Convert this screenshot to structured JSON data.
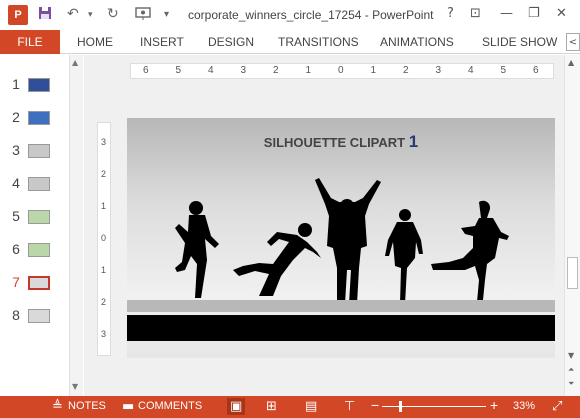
{
  "window": {
    "title": "corporate_winners_circle_17254 - PowerPoint",
    "app_logo": "P",
    "help_label": "?",
    "minimize": "—",
    "restore": "❐",
    "close": "✕",
    "ribbon_toggle": "⊡"
  },
  "ribbon": {
    "file_tab": "FILE",
    "tabs": [
      "HOME",
      "INSERT",
      "DESIGN",
      "TRANSITIONS",
      "ANIMATIONS",
      "SLIDE SHOW"
    ],
    "collapse": "<"
  },
  "thumbnails": {
    "slides": [
      {
        "number": "1",
        "selected": false,
        "thumb_color": "#2f4f9a"
      },
      {
        "number": "2",
        "selected": false,
        "thumb_color": "#3f6fbf"
      },
      {
        "number": "3",
        "selected": false,
        "thumb_color": "#c8c8c8"
      },
      {
        "number": "4",
        "selected": false,
        "thumb_color": "#c8c8c8"
      },
      {
        "number": "5",
        "selected": false,
        "thumb_color": "#b9d7a8"
      },
      {
        "number": "6",
        "selected": false,
        "thumb_color": "#b9d7a8"
      },
      {
        "number": "7",
        "selected": true,
        "thumb_color": "#d9d9d9"
      },
      {
        "number": "8",
        "selected": false,
        "thumb_color": "#d9d9d9"
      }
    ]
  },
  "ruler": {
    "horizontal": [
      "6",
      "5",
      "4",
      "3",
      "2",
      "1",
      "0",
      "1",
      "2",
      "3",
      "4",
      "5",
      "6"
    ],
    "vertical": [
      "3",
      "2",
      "1",
      "0",
      "1",
      "2",
      "3"
    ]
  },
  "slide": {
    "title": "SILHOUETTE CLIPART",
    "title_number": "1"
  },
  "statusbar": {
    "notes_label": "NOTES",
    "comments_label": "COMMENTS",
    "zoom_minus": "−",
    "zoom_plus": "+",
    "zoom": "33%",
    "zoom_fraction": 0.33
  },
  "colors": {
    "accent": "#d24726",
    "selected_thumb_border": "#c0392b"
  },
  "icons": {
    "save": "save-icon",
    "undo": "undo-icon",
    "redo": "redo-icon",
    "from-beginning": "from-beginning-icon",
    "customize": "customize-quick-access-icon",
    "notes": "notes-icon",
    "comments": "comments-icon",
    "normal-view": "normal-view-icon",
    "slide-sorter": "slide-sorter-icon",
    "reading-view": "reading-view-icon",
    "slideshow-view": "slideshow-view-icon",
    "fit-slide": "fit-slide-icon"
  }
}
